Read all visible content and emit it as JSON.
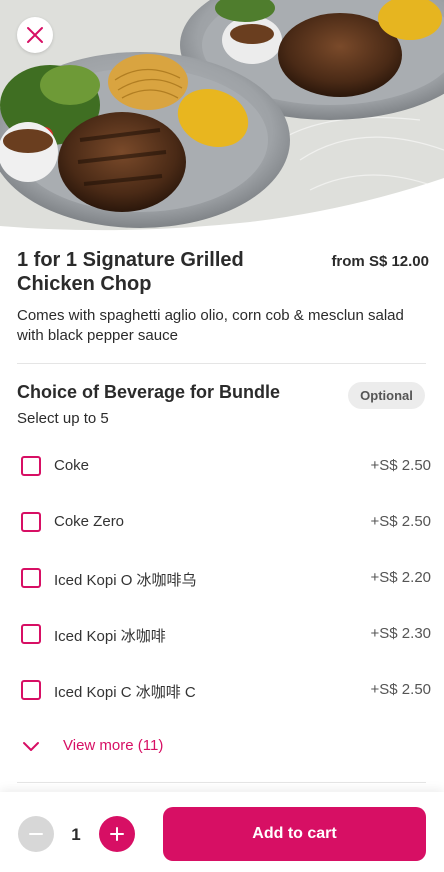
{
  "colors": {
    "accent": "#d70f64",
    "text": "#2b2b2b",
    "muted": "#555555",
    "badge_bg": "#ececec"
  },
  "header": {
    "close_icon": "close-icon"
  },
  "item": {
    "title": "1 for 1 Signature Grilled Chicken Chop",
    "price": "from S$ 12.00",
    "description": "Comes with spaghetti aglio olio, corn cob & mesclun salad with black pepper sauce"
  },
  "beverage_section": {
    "title": "Choice of Beverage for Bundle",
    "badge": "Optional",
    "subtitle": "Select up to 5",
    "options": [
      {
        "label": "Coke",
        "price": "+S$ 2.50",
        "checked": false
      },
      {
        "label": "Coke Zero",
        "price": "+S$ 2.50",
        "checked": false
      },
      {
        "label": "Iced Kopi O 冰咖啡乌",
        "price": "+S$ 2.20",
        "checked": false
      },
      {
        "label": "Iced Kopi 冰咖啡",
        "price": "+S$ 2.30",
        "checked": false
      },
      {
        "label": "Iced Kopi C 冰咖啡 C",
        "price": "+S$ 2.50",
        "checked": false
      }
    ],
    "view_more": "View more (11)"
  },
  "cart": {
    "quantity": "1",
    "add_label": "Add to cart"
  }
}
